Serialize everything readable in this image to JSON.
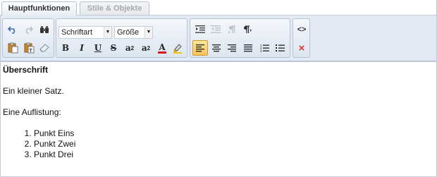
{
  "tabs": [
    {
      "label": "Hauptfunktionen",
      "state": "active"
    },
    {
      "label": "Stile & Objekte",
      "state": "inactive"
    }
  ],
  "toolbar": {
    "font_select": {
      "value": "Schriftart"
    },
    "size_select": {
      "value": "Größe"
    },
    "buttons": {
      "undo": "undo-icon",
      "redo": "redo-icon",
      "find": "binoculars-icon",
      "paste": "paste-icon",
      "paste_text": "paste-text-icon",
      "eraser": "eraser-icon",
      "bold": "B",
      "italic": "I",
      "underline": "U",
      "strike": "S",
      "superscript": "a",
      "subscript": "a",
      "font_color": "A",
      "highlight": "highlighter-icon",
      "indent": "indent-icon",
      "outdent": "outdent-icon",
      "ltr": "ltr-icon",
      "rtl": "rtl-icon",
      "align_left": "align-left-icon",
      "align_center": "align-center-icon",
      "align_right": "align-right-icon",
      "align_justify": "align-justify-icon",
      "ordered_list": "ordered-list-icon",
      "unordered_list": "unordered-list-icon",
      "source": "<>",
      "remove": "×"
    },
    "colors": {
      "font_color_bar": "#d0181e",
      "remove": "#d63a2a",
      "active_bg": "#f8c45c"
    }
  },
  "editor": {
    "heading": "Überschrift",
    "sentence": "Ein kleiner Satz.",
    "list_intro": "Eine Auflistung:",
    "list_items": [
      "Punkt Eins",
      "Punkt Zwei",
      "Punkt Drei"
    ]
  }
}
